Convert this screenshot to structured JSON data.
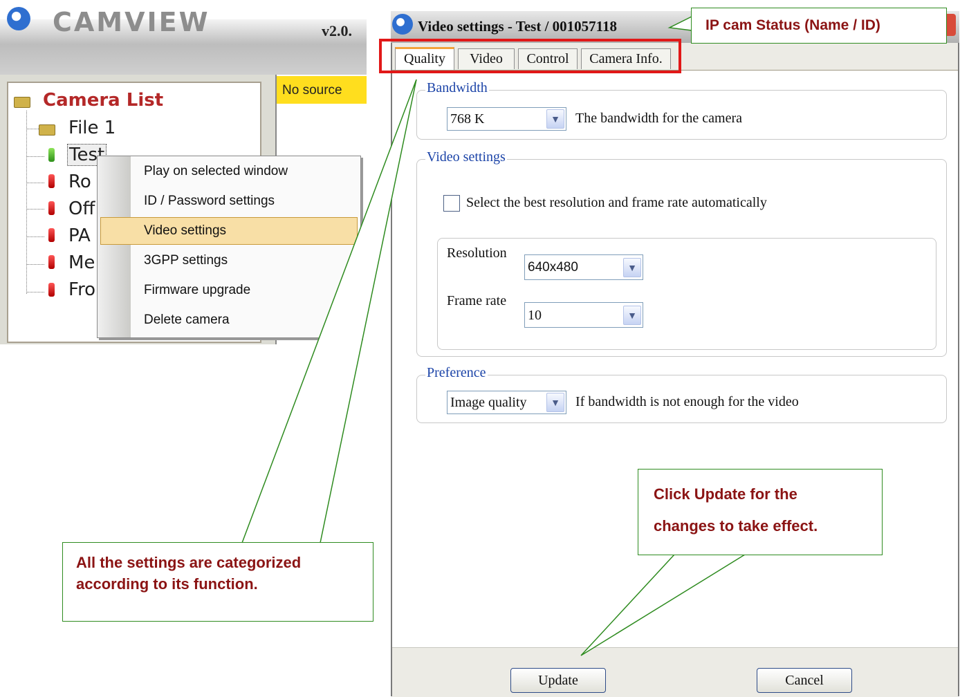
{
  "camview": {
    "app_title": "CAMVIEW",
    "version": "v2.0.",
    "camera_list_label": "Camera List",
    "no_source_label": "No source",
    "tree_items": [
      {
        "label": "File 1",
        "status": "folder"
      },
      {
        "label": "Test",
        "status": "green"
      },
      {
        "label": "Ro",
        "status": "red"
      },
      {
        "label": "Off",
        "status": "red"
      },
      {
        "label": "PA",
        "status": "red"
      },
      {
        "label": "Me",
        "status": "red"
      },
      {
        "label": "Fro",
        "status": "red"
      }
    ]
  },
  "context_menu": {
    "items": [
      "Play on selected window",
      "ID / Password settings",
      "Video settings",
      "3GPP settings",
      "Firmware upgrade",
      "Delete camera"
    ],
    "selected": "Video settings"
  },
  "dialog": {
    "title": "Video settings - Test / 001057118",
    "tabs": [
      "Quality",
      "Video",
      "Control",
      "Camera Info."
    ],
    "active_tab": "Quality",
    "bandwidth": {
      "legend": "Bandwidth",
      "value": "768 K",
      "description": "The bandwidth for the camera"
    },
    "video_settings": {
      "legend": "Video settings",
      "auto_checkbox_label": "Select the best resolution and frame rate automatically",
      "auto_checked": false,
      "resolution_label": "Resolution",
      "resolution_value": "640x480",
      "frame_rate_label": "Frame rate",
      "frame_rate_value": "10"
    },
    "preference": {
      "legend": "Preference",
      "value": "Image quality",
      "description": "If bandwidth is not enough for the video"
    },
    "update_button": "Update",
    "cancel_button": "Cancel"
  },
  "callouts": {
    "ip_cam_status": "IP cam Status (Name / ID)",
    "update_note_line1": "Click Update for the",
    "update_note_line2": "changes to take effect.",
    "categories_note_line1": "All the settings are categorized",
    "categories_note_line2": "according to its function."
  },
  "colors": {
    "callout_text": "#8b1414",
    "callout_border": "#2e8b1f",
    "tab_highlight": "#e11818",
    "menu_highlight": "#f8dfa6",
    "no_source_bg": "#ffde1e",
    "legend_blue": "#1c44a8"
  }
}
